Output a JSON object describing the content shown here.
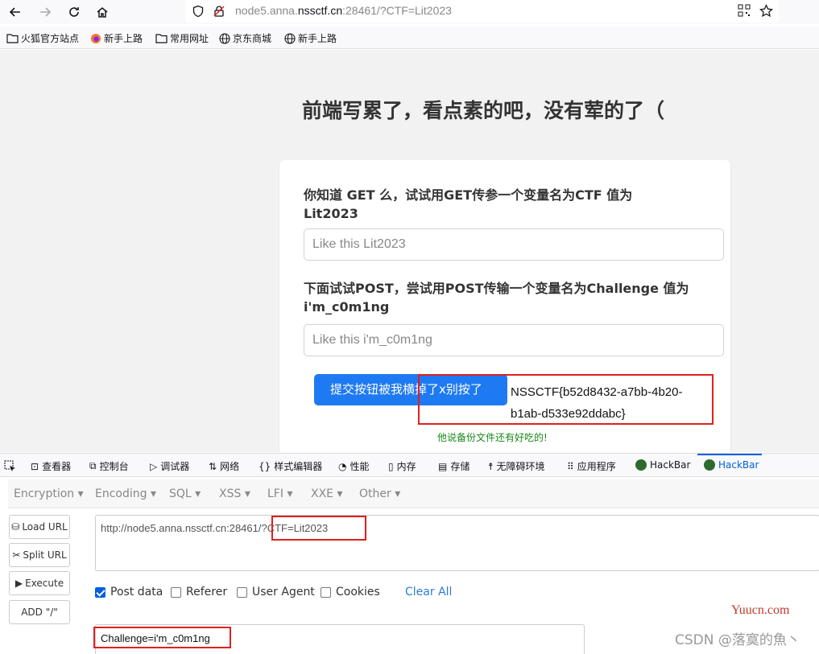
{
  "browser": {
    "url_prefix": "node5.anna.",
    "url_domain": "nssctf.cn",
    "url_suffix": ":28461/?CTF=Lit2023",
    "bookmarks": [
      "火狐官方站点",
      "新手上路",
      "常用网址",
      "京东商城",
      "新手上路"
    ]
  },
  "page": {
    "title": "前端写累了，看点素的吧，没有荤的了（",
    "question1": "你知道 GET 么，试试用GET传参一个变量名为CTF 值为 Lit2023",
    "input1_placeholder": "Like this Lit2023",
    "question2": "下面试试POST，尝试用POST传输一个变量名为Challenge 值为 i'm_c0m1ng",
    "input2_placeholder": "Like this i'm_c0m1ng",
    "submit_label": "提交按钮被我横掉了x别按了",
    "flag": "NSSCTF{b52d8432-a7bb-4b20-b1ab-d533e92ddabc}",
    "hint": "他说备份文件还有好吃的!"
  },
  "devtools": {
    "tabs": [
      "查看器",
      "控制台",
      "调试器",
      "网络",
      "样式编辑器",
      "性能",
      "内存",
      "存储",
      "无障碍环境",
      "应用程序",
      "HackBar",
      "HackBar"
    ]
  },
  "hackbar": {
    "menu": [
      "Encryption",
      "Encoding",
      "SQL",
      "XSS",
      "LFI",
      "XXE",
      "Other"
    ],
    "buttons": [
      "Load URL",
      "Split URL",
      "Execute",
      "ADD \"/\""
    ],
    "url_value": "http://node5.anna.nssctf.cn:28461/?CTF=Lit2023",
    "options": [
      "Post data",
      "Referer",
      "User Agent",
      "Cookies"
    ],
    "clear_all": "Clear All",
    "post_value": "Challenge=i'm_c0m1ng"
  },
  "watermark": {
    "site": "Yuucn.com",
    "author": "CSDN @落寞的魚丶"
  },
  "colors": {
    "accent": "#1e7af2",
    "highlight_box": "#e02020",
    "hint": "#1a8a1a",
    "link": "#2a7ae2"
  }
}
